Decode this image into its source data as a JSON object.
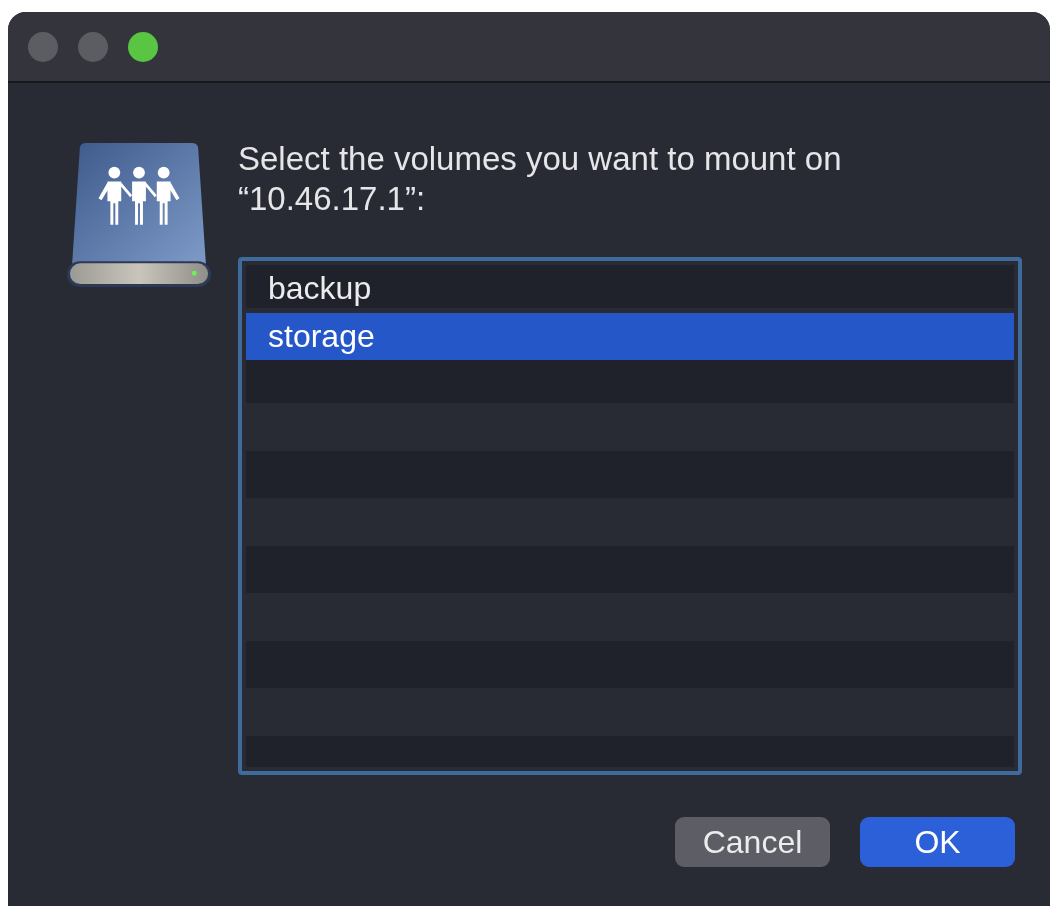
{
  "window": {
    "controls": [
      {
        "color": "#5c5d63"
      },
      {
        "color": "#5c5d63"
      },
      {
        "color": "#5ac443"
      }
    ]
  },
  "prompt": "Select the volumes you want to mount on “10.46.17.1”:",
  "volumes": [
    {
      "name": "backup",
      "selected": false
    },
    {
      "name": "storage",
      "selected": true
    }
  ],
  "buttons": [
    {
      "label": "Cancel",
      "kind": "secondary"
    },
    {
      "label": "OK",
      "kind": "default"
    }
  ]
}
